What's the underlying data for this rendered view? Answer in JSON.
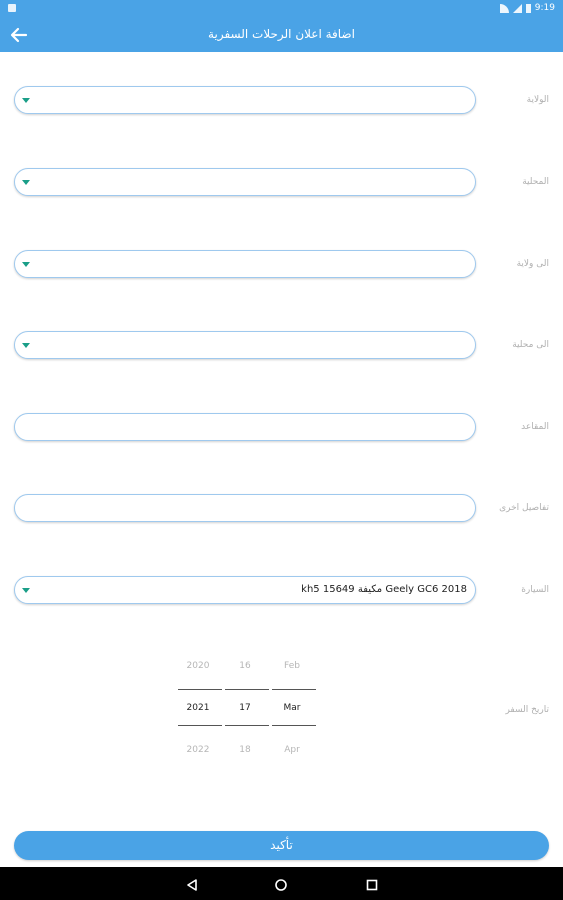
{
  "status_bar": {
    "time": "9:19"
  },
  "app_bar": {
    "title": "اضافة اعلان الرحلات السفرية"
  },
  "form": {
    "fields": [
      {
        "label": "الولاية",
        "value": "",
        "dropdown": true
      },
      {
        "label": "المحلية",
        "value": "",
        "dropdown": true
      },
      {
        "label": "الى ولاية",
        "value": "",
        "dropdown": true
      },
      {
        "label": "الى محلية",
        "value": "",
        "dropdown": true
      },
      {
        "label": "المقاعد",
        "value": "",
        "dropdown": false
      },
      {
        "label": "تفاصيل اخرى",
        "value": "",
        "dropdown": false
      },
      {
        "label": "السيارة",
        "value": "Geely GC6 2018 مكيفة kh5 15649",
        "dropdown": true
      }
    ],
    "date": {
      "label": "تاريخ السفر",
      "year": {
        "prev": "2020",
        "selected": "2021",
        "next": "2022"
      },
      "day": {
        "prev": "16",
        "selected": "17",
        "next": "18"
      },
      "month": {
        "prev": "Feb",
        "selected": "Mar",
        "next": "Apr"
      }
    },
    "confirm_label": "تأكيد"
  },
  "colors": {
    "accent": "#4aa3e6",
    "caret": "#1a9e88",
    "field_border": "#9fc9ee"
  }
}
